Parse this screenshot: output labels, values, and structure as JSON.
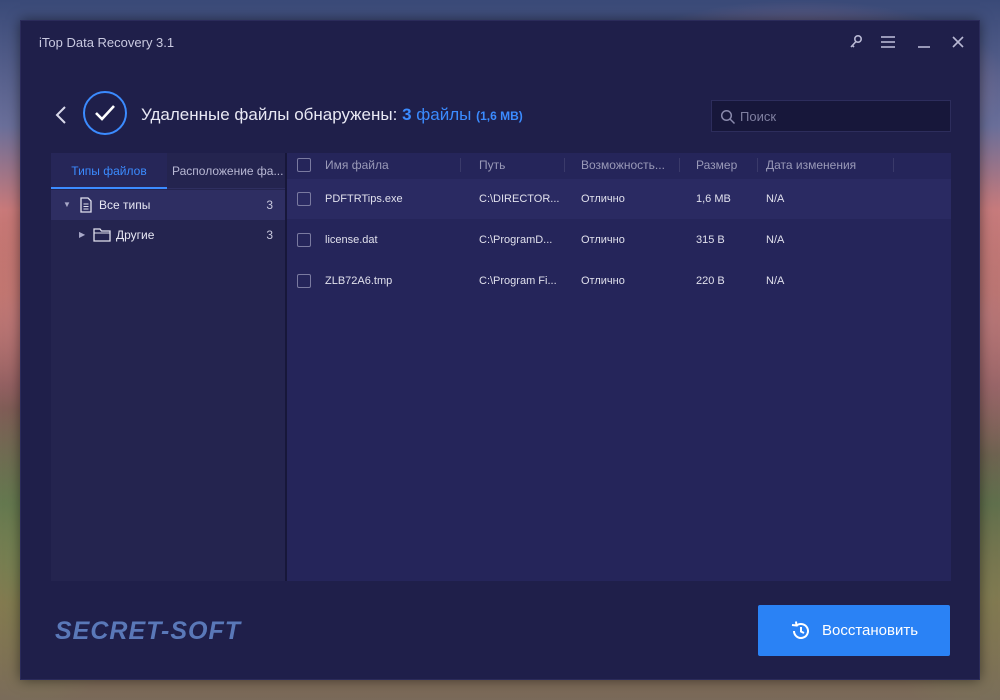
{
  "window": {
    "title": "iTop Data Recovery 3.1"
  },
  "header": {
    "status_text": "Удаленные файлы обнаружены:",
    "count": "3",
    "count_unit": "файлы",
    "size": "(1,6 MB)"
  },
  "search": {
    "placeholder": "Поиск"
  },
  "tabs": [
    {
      "label": "Типы файлов",
      "active": true
    },
    {
      "label": "Расположение фа...",
      "active": false
    }
  ],
  "tree": [
    {
      "label": "Все типы",
      "count": "3",
      "selected": true,
      "icon": "document-icon"
    },
    {
      "label": "Другие",
      "count": "3",
      "selected": false,
      "icon": "folder-icon"
    }
  ],
  "table": {
    "columns": [
      "Имя файла",
      "Путь",
      "Возможность...",
      "Размер",
      "Дата изменения"
    ],
    "rows": [
      {
        "name": "PDFTRTips.exe",
        "path": "C:\\DIRECTOR...",
        "quality": "Отлично",
        "size": "1,6 MB",
        "date": "N/A"
      },
      {
        "name": "license.dat",
        "path": "C:\\ProgramD...",
        "quality": "Отлично",
        "size": "315 B",
        "date": "N/A"
      },
      {
        "name": "ZLB72A6.tmp",
        "path": "C:\\Program Fi...",
        "quality": "Отлично",
        "size": "220 B",
        "date": "N/A"
      }
    ]
  },
  "watermark": "SECRET-SOFT",
  "recover_button": {
    "label": "Восстановить"
  },
  "colors": {
    "accent": "#3b8bff",
    "button": "#2a82f5",
    "window_bg": "#1f1f4a"
  }
}
